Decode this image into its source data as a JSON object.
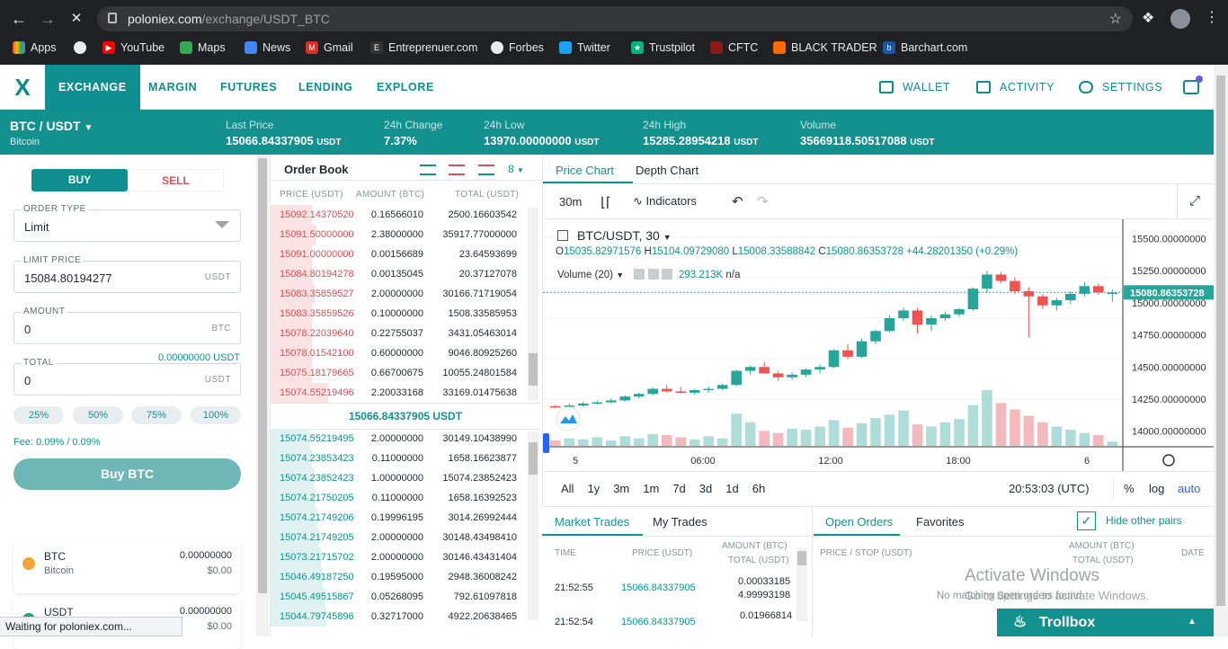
{
  "browser": {
    "url_host": "poloniex.com",
    "url_path": "/exchange/USDT_BTC",
    "bookmarks": [
      "Apps",
      "YouTube",
      "Maps",
      "News",
      "Gmail",
      "Entreprenuer.com",
      "Forbes",
      "Twitter",
      "Trustpilot",
      "CFTC",
      "BLACK TRADER",
      "Barchart.com"
    ],
    "status": "Waiting for poloniex.com..."
  },
  "nav": {
    "tabs": [
      "EXCHANGE",
      "MARGIN",
      "FUTURES",
      "LENDING",
      "EXPLORE"
    ],
    "right": [
      "WALLET",
      "ACTIVITY",
      "SETTINGS"
    ]
  },
  "ticker": {
    "pair": "BTC / USDT",
    "pair_name": "Bitcoin",
    "last_price_label": "Last Price",
    "last_price": "15066.84337905",
    "last_price_unit": "USDT",
    "change_label": "24h Change",
    "change": "7.37%",
    "low_label": "24h Low",
    "low": "13970.00000000",
    "low_unit": "USDT",
    "high_label": "24h High",
    "high": "15285.28954218",
    "high_unit": "USDT",
    "volume_label": "Volume",
    "volume": "35669118.50517088",
    "volume_unit": "USDT"
  },
  "order_form": {
    "buy": "BUY",
    "sell": "SELL",
    "order_type_label": "ORDER TYPE",
    "order_type": "Limit",
    "limit_price_label": "LIMIT PRICE",
    "limit_price": "15084.80194277",
    "limit_unit": "USDT",
    "amount_label": "AMOUNT",
    "amount": "0",
    "amount_unit": "BTC",
    "total_label": "TOTAL",
    "total_available": "0.00000000 USDT",
    "total": "0",
    "total_unit": "USDT",
    "pcts": [
      "25%",
      "50%",
      "75%",
      "100%"
    ],
    "fee": "Fee: 0.09% / 0.09%",
    "submit": "Buy BTC"
  },
  "balances": [
    {
      "coin": "BTC",
      "name": "Bitcoin",
      "amount": "0.00000000",
      "usd": "$0.00",
      "color": "#f2a33a"
    },
    {
      "coin": "USDT",
      "name": "",
      "amount": "0.00000000",
      "usd": "$0.00",
      "color": "#2aa37a"
    }
  ],
  "order_book": {
    "title": "Order Book",
    "depth": "8",
    "headers": [
      "PRICE (USDT)",
      "AMOUNT (BTC)",
      "TOTAL (USDT)"
    ],
    "asks": [
      [
        "15092.14370520",
        "0.16566010",
        "2500.16603542"
      ],
      [
        "15091.50000000",
        "2.38000000",
        "35917.77000000"
      ],
      [
        "15091.00000000",
        "0.00156689",
        "23.64593699"
      ],
      [
        "15084.80194278",
        "0.00135045",
        "20.37127078"
      ],
      [
        "15083.35859527",
        "2.00000000",
        "30166.71719054"
      ],
      [
        "15083.35859526",
        "0.10000000",
        "1508.33585953"
      ],
      [
        "15078.22039640",
        "0.22755037",
        "3431.05463014"
      ],
      [
        "15078.01542100",
        "0.60000000",
        "9046.80925260"
      ],
      [
        "15075.18179665",
        "0.66700675",
        "10055.24801584"
      ],
      [
        "15074.55219496",
        "2.20033168",
        "33169.01475638"
      ]
    ],
    "mid_price": "15066.84337905 USDT",
    "bids": [
      [
        "15074.55219495",
        "2.00000000",
        "30149.10438990"
      ],
      [
        "15074.23853423",
        "0.11000000",
        "1658.16623877"
      ],
      [
        "15074.23852423",
        "1.00000000",
        "15074.23852423"
      ],
      [
        "15074.21750205",
        "0.11000000",
        "1658.16392523"
      ],
      [
        "15074.21749206",
        "0.19996195",
        "3014.26992444"
      ],
      [
        "15074.21749205",
        "2.00000000",
        "30148.43498410"
      ],
      [
        "15073.21715702",
        "2.00000000",
        "30146.43431404"
      ],
      [
        "15046.49187250",
        "0.19595000",
        "2948.36008242"
      ],
      [
        "15045.49515867",
        "0.05268095",
        "792.61097818"
      ],
      [
        "15044.79745896",
        "0.32717000",
        "4922.20638465"
      ]
    ]
  },
  "chart": {
    "tabs": [
      "Price Chart",
      "Depth Chart"
    ],
    "interval": "30m",
    "indicators": "Indicators",
    "legend_pair": "BTC/USDT, 30",
    "ohlc": {
      "O": "15035.82971576",
      "H": "15104.09729080",
      "L": "15008.33588842",
      "C": "15080.86353728",
      "chg": "+44.28201350 (+0.29%)"
    },
    "volume_label": "Volume (20)",
    "volume_val": "293.213K",
    "volume_na": "n/a",
    "price_ticks": [
      "15500.00000000",
      "15250.00000000",
      "15000.00000000",
      "14750.00000000",
      "14500.00000000",
      "14250.00000000",
      "14000.00000000"
    ],
    "current_price": "15080.86353728",
    "time_ticks": [
      "5",
      "06:00",
      "12:00",
      "18:00",
      "6"
    ],
    "ranges": [
      "All",
      "1y",
      "3m",
      "1m",
      "7d",
      "3d",
      "1d",
      "6h"
    ],
    "clock": "20:53:03 (UTC)",
    "opts": [
      "%",
      "log",
      "auto"
    ]
  },
  "chart_data": {
    "type": "candlestick",
    "ylim": [
      13900,
      15650
    ],
    "candles": [
      [
        14195,
        14205,
        14180,
        14190
      ],
      [
        14190,
        14215,
        14175,
        14200
      ],
      [
        14200,
        14230,
        14190,
        14215
      ],
      [
        14215,
        14240,
        14205,
        14225
      ],
      [
        14225,
        14255,
        14215,
        14240
      ],
      [
        14240,
        14280,
        14230,
        14270
      ],
      [
        14270,
        14300,
        14255,
        14290
      ],
      [
        14290,
        14340,
        14280,
        14330
      ],
      [
        14330,
        14360,
        14300,
        14310
      ],
      [
        14310,
        14345,
        14295,
        14300
      ],
      [
        14300,
        14330,
        14285,
        14320
      ],
      [
        14320,
        14350,
        14300,
        14330
      ],
      [
        14330,
        14370,
        14320,
        14360
      ],
      [
        14360,
        14480,
        14350,
        14470
      ],
      [
        14470,
        14510,
        14440,
        14500
      ],
      [
        14500,
        14540,
        14470,
        14450
      ],
      [
        14450,
        14470,
        14390,
        14420
      ],
      [
        14420,
        14460,
        14400,
        14440
      ],
      [
        14440,
        14490,
        14420,
        14480
      ],
      [
        14480,
        14520,
        14450,
        14500
      ],
      [
        14500,
        14640,
        14490,
        14630
      ],
      [
        14630,
        14680,
        14560,
        14580
      ],
      [
        14580,
        14720,
        14570,
        14700
      ],
      [
        14700,
        14790,
        14680,
        14780
      ],
      [
        14780,
        14900,
        14770,
        14880
      ],
      [
        14880,
        14960,
        14860,
        14940
      ],
      [
        14940,
        14960,
        14760,
        14830
      ],
      [
        14830,
        14900,
        14780,
        14880
      ],
      [
        14880,
        14930,
        14860,
        14910
      ],
      [
        14910,
        14960,
        14890,
        14950
      ],
      [
        14950,
        15120,
        14940,
        15110
      ],
      [
        15110,
        15250,
        15080,
        15220
      ],
      [
        15220,
        15240,
        15150,
        15170
      ],
      [
        15170,
        15200,
        15070,
        15090
      ],
      [
        15090,
        15120,
        14730,
        15050
      ],
      [
        15050,
        15070,
        14950,
        14980
      ],
      [
        14980,
        15040,
        14940,
        15020
      ],
      [
        15020,
        15090,
        14990,
        15070
      ],
      [
        15070,
        15160,
        15050,
        15130
      ],
      [
        15130,
        15150,
        15060,
        15080
      ],
      [
        15080,
        15104,
        15008,
        15080
      ]
    ],
    "volumes": [
      5,
      7,
      6,
      8,
      5,
      9,
      7,
      11,
      10,
      8,
      6,
      9,
      7,
      30,
      22,
      14,
      12,
      16,
      15,
      18,
      24,
      17,
      21,
      26,
      29,
      33,
      20,
      18,
      22,
      25,
      38,
      52,
      40,
      34,
      28,
      22,
      18,
      15,
      12,
      10,
      4
    ]
  },
  "trades": {
    "tabs": [
      "Market Trades",
      "My Trades"
    ],
    "headers": [
      "TIME",
      "PRICE (USDT)",
      "AMOUNT (BTC)",
      "TOTAL (USDT)"
    ],
    "rows": [
      [
        "21:52:55",
        "15066.84337905",
        "0.00033185",
        "4.99993198"
      ],
      [
        "21:52:54",
        "15066.84337905",
        "0.01966814",
        ""
      ]
    ]
  },
  "orders": {
    "tabs": [
      "Open Orders",
      "Favorites"
    ],
    "hide_label": "Hide other pairs",
    "headers": [
      "PRICE / STOP (USDT)",
      "AMOUNT (BTC)",
      "TOTAL (USDT)",
      "DATE"
    ],
    "empty": "No matching open orders found",
    "watermark1": "Activate Windows",
    "watermark2": "Go to Settings to activate Windows."
  },
  "trollbox": {
    "label": "Trollbox"
  }
}
